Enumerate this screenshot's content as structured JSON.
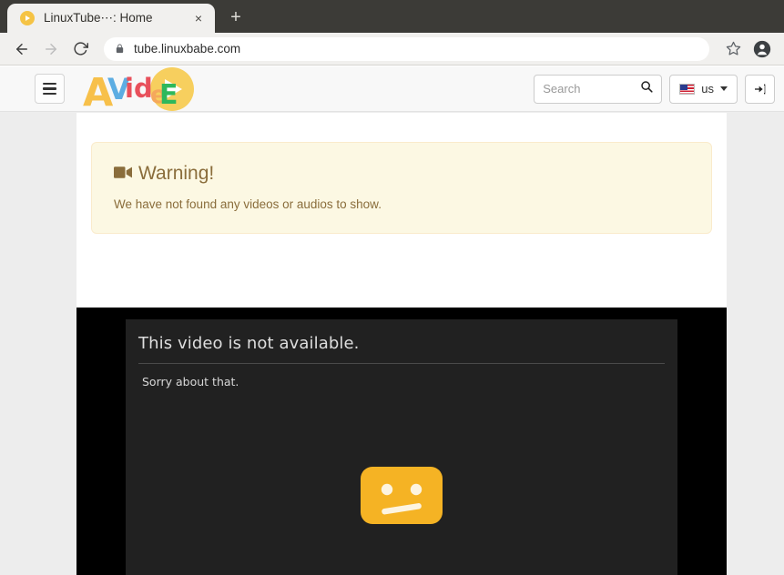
{
  "browser": {
    "tab": {
      "title": "LinuxTube⋯: Home",
      "favicon": "play-circle-icon",
      "close_label": "×"
    },
    "new_tab_label": "+",
    "nav": {
      "back": "back-arrow-icon",
      "forward": "forward-arrow-icon",
      "reload": "reload-icon"
    },
    "url": "tube.linuxbabe.com",
    "security": "lock-icon",
    "bookmark": "star-icon",
    "profile": "account-avatar-icon"
  },
  "app": {
    "menu_button": "hamburger-menu-icon",
    "logo": {
      "alt": "AVideo",
      "letters": [
        {
          "char": "A",
          "color": "#f7c04a"
        },
        {
          "char": "V",
          "color": "#5dade2"
        },
        {
          "char": "i",
          "color": "#e8505b"
        },
        {
          "char": "d",
          "color": "#e8505b"
        },
        {
          "char": "e",
          "color": "#f5a85c"
        },
        {
          "char": "E",
          "color": "#2eb85c"
        }
      ],
      "play_circle_color": "#f7cf5e"
    },
    "search": {
      "placeholder": "Search",
      "value": "",
      "icon": "search-icon"
    },
    "language": {
      "label": "us",
      "flag": "us-flag-icon",
      "caret": "chevron-down-icon"
    },
    "signin": {
      "icon": "sign-in-icon"
    }
  },
  "main": {
    "alert": {
      "icon": "video-camera-icon",
      "title": "Warning!",
      "message": "We have not found any videos or audios to show.",
      "background": "#fcf8e3",
      "border": "#faebcc",
      "text_color": "#8a6d3b"
    },
    "player": {
      "heading": "This video is not  available.",
      "subtext": "Sorry about that.",
      "graphic": "sad-face-icon",
      "face_color": "#f5b324",
      "background": "#212121",
      "outer_background": "#000000"
    }
  }
}
